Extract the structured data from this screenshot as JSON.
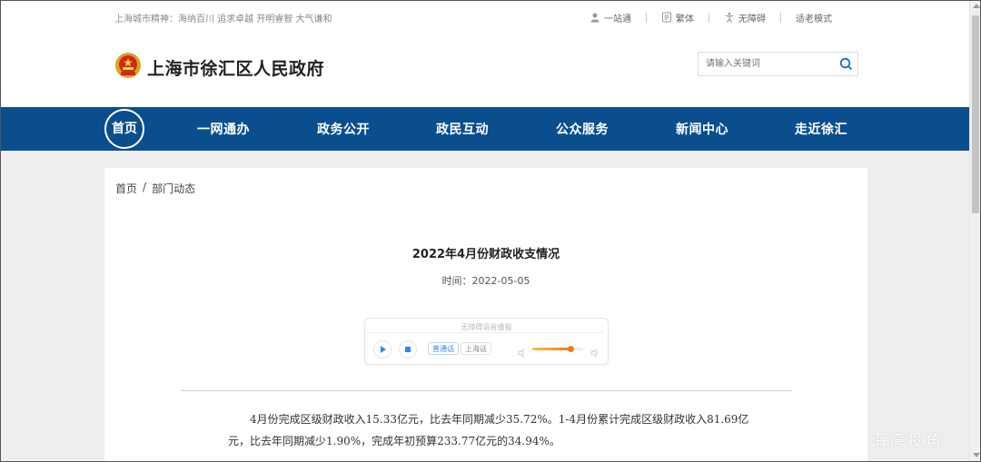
{
  "header": {
    "slogan": "上海城市精神：海纳百川 追求卓越 开明睿智 大气谦和",
    "top_links": [
      {
        "label": "一站通",
        "icon": "user-icon"
      },
      {
        "label": "繁体",
        "icon": "document-icon"
      },
      {
        "label": "无障碍",
        "icon": "accessibility-icon"
      },
      {
        "label": "适老模式",
        "icon": ""
      }
    ],
    "site_title": "上海市徐汇区人民政府",
    "search_placeholder": "请输入关键词"
  },
  "nav": {
    "home": "首页",
    "items": [
      "一网通办",
      "政务公开",
      "政民互动",
      "公众服务",
      "新闻中心",
      "走近徐汇"
    ]
  },
  "breadcrumb": {
    "home": "首页",
    "separator": "/",
    "current": "部门动态"
  },
  "article": {
    "title": "2022年4月份财政收支情况",
    "date": "时间：2022-05-05",
    "body": "4月份完成区级财政收入15.33亿元，比去年同期减少35.72%。1-4月份累计完成区级财政收入81.69亿元，比去年同期减少1.90%，完成年初预算233.77亿元的34.94%。"
  },
  "player": {
    "caption": "无障碍语音播报",
    "lang_active": "普通话",
    "lang_inactive": "上海话",
    "volume": 0.75
  },
  "watermark": "海湾投角",
  "colors": {
    "nav_bg": "#0a4e8e",
    "accent_blue": "#2a8be6",
    "volume_orange": "#ef7b19"
  }
}
